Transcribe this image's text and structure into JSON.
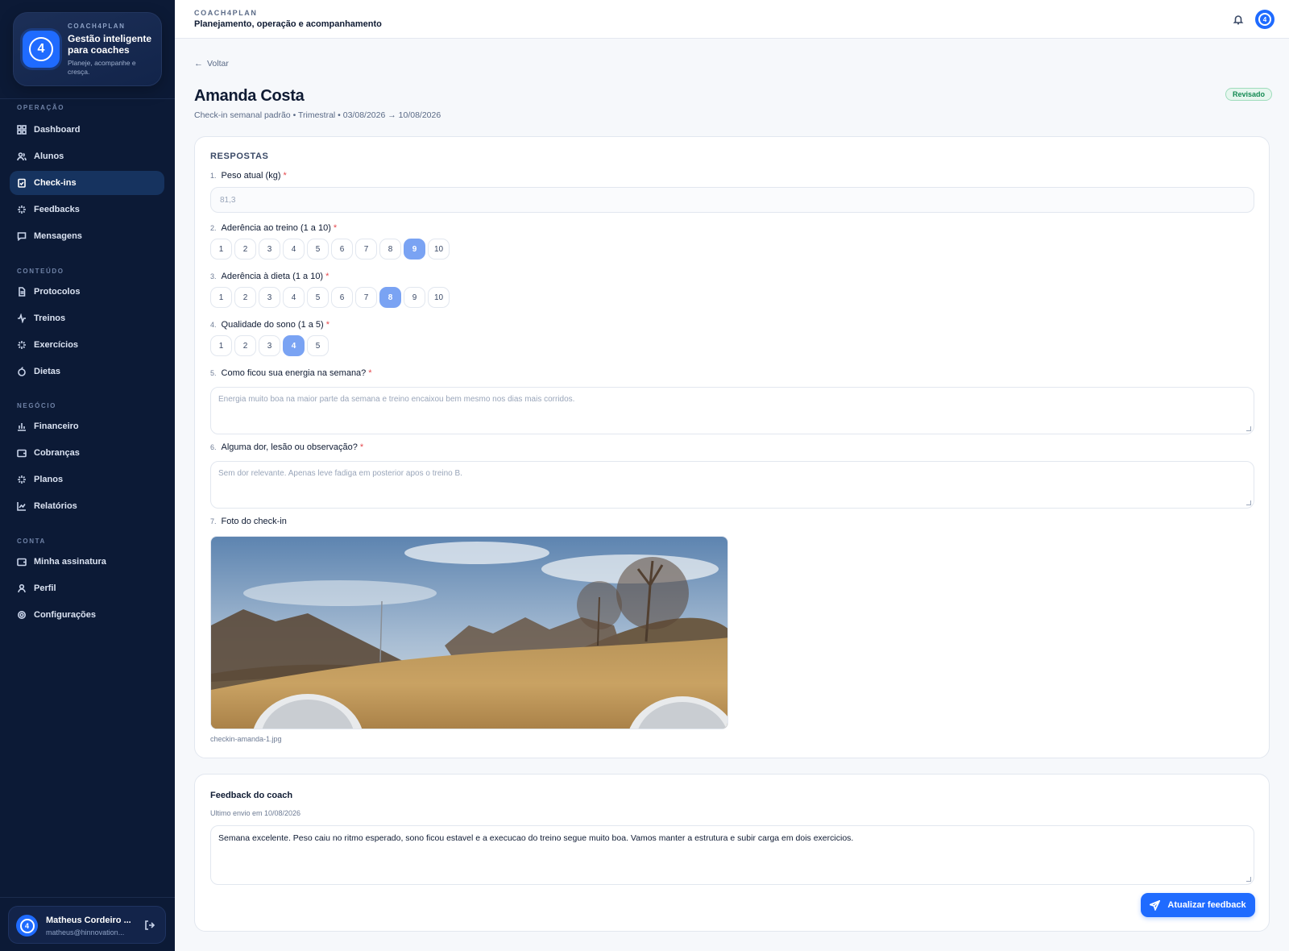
{
  "brand": {
    "kicker": "COACH4PLAN",
    "title": "Gestão inteligente para coaches",
    "subtitle": "Planeje, acompanhe e cresça.",
    "logo_glyph": "4"
  },
  "sidebar": {
    "sections": [
      {
        "label": "OPERAÇÃO"
      },
      {
        "label": "CONTEÚDO"
      },
      {
        "label": "NEGÓCIO"
      },
      {
        "label": "CONTA"
      }
    ],
    "items": [
      {
        "label": "Dashboard",
        "icon": "grid-icon"
      },
      {
        "label": "Alunos",
        "icon": "users-icon"
      },
      {
        "label": "Check-ins",
        "icon": "clipboard-check-icon",
        "active": true
      },
      {
        "label": "Feedbacks",
        "icon": "sparkles-icon"
      },
      {
        "label": "Mensagens",
        "icon": "message-square-icon"
      },
      {
        "label": "Protocolos",
        "icon": "file-text-icon"
      },
      {
        "label": "Treinos",
        "icon": "activity-icon"
      },
      {
        "label": "Exercícios",
        "icon": "sparkles-icon"
      },
      {
        "label": "Dietas",
        "icon": "apple-icon"
      },
      {
        "label": "Financeiro",
        "icon": "bar-chart-icon"
      },
      {
        "label": "Cobranças",
        "icon": "wallet-icon"
      },
      {
        "label": "Planos",
        "icon": "sparkles-icon"
      },
      {
        "label": "Relatórios",
        "icon": "line-chart-icon"
      },
      {
        "label": "Minha assinatura",
        "icon": "wallet-icon"
      },
      {
        "label": "Perfil",
        "icon": "user-icon"
      },
      {
        "label": "Configurações",
        "icon": "settings-icon"
      }
    ]
  },
  "user": {
    "name": "Matheus Cordeiro ...",
    "email": "matheus@hinnovation..."
  },
  "topbar": {
    "kicker": "COACH4PLAN",
    "title": "Planejamento, operação e acompanhamento"
  },
  "header": {
    "back_label": "Voltar",
    "student_name": "Amanda Costa",
    "meta": "Check-in semanal padrão • Trimestral • 03/08/2026 → 10/08/2026",
    "status": "Revisado"
  },
  "answers": {
    "section_title": "RESPOSTAS",
    "questions": [
      {
        "num": "1.",
        "label": "Peso atual (kg)",
        "value": "81,3"
      },
      {
        "num": "2.",
        "label": "Aderência ao treino (1 a 10)",
        "options": [
          "1",
          "2",
          "3",
          "4",
          "5",
          "6",
          "7",
          "8",
          "9",
          "10"
        ],
        "selected": "9"
      },
      {
        "num": "3.",
        "label": "Aderência à dieta (1 a 10)",
        "options": [
          "1",
          "2",
          "3",
          "4",
          "5",
          "6",
          "7",
          "8",
          "9",
          "10"
        ],
        "selected": "8"
      },
      {
        "num": "4.",
        "label": "Qualidade do sono (1 a 5)",
        "options": [
          "1",
          "2",
          "3",
          "4",
          "5"
        ],
        "selected": "4"
      },
      {
        "num": "5.",
        "label": "Como ficou sua energia na semana?",
        "value": "Energia muito boa na maior parte da semana e treino encaixou bem mesmo nos dias mais corridos."
      },
      {
        "num": "6.",
        "label": "Alguma dor, lesão ou observação?",
        "value": "Sem dor relevante. Apenas leve fadiga em posterior apos o treino B."
      },
      {
        "num": "7.",
        "label": "Foto do check-in",
        "file_name": "checkin-amanda-1.jpg"
      }
    ]
  },
  "feedback": {
    "title": "Feedback do coach",
    "subtitle": "Ultimo envio em 10/08/2026",
    "text": "Semana excelente. Peso caiu no ritmo esperado, sono ficou estavel e a execucao do treino segue muito boa. Vamos manter a estrutura e subir carga em dois exercicios.",
    "button_label": "Atualizar feedback"
  },
  "colors": {
    "sidebar_bg": "#0c1a36",
    "accent": "#1f6bff",
    "selected_option": "#7aa3f3",
    "status_green": "#138a52"
  }
}
